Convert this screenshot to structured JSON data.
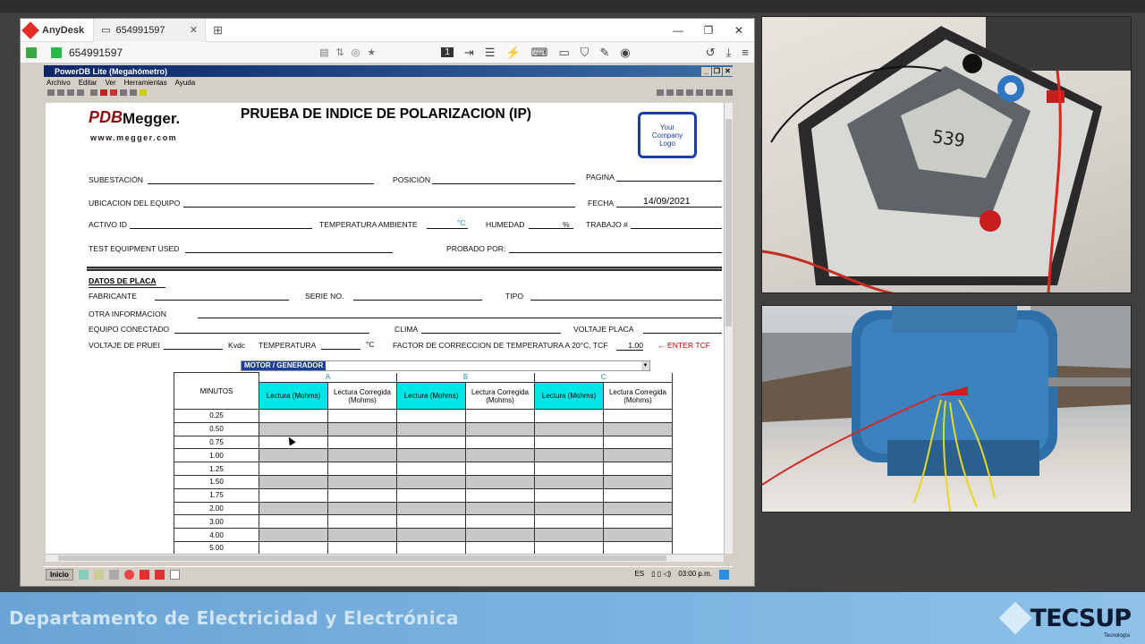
{
  "anydesk": {
    "app_name": "AnyDesk",
    "tab_title": "654991597",
    "address_value": "654991597",
    "monitor_number": "1"
  },
  "powerdb": {
    "window_title": "PowerDB Lite (Megahómetro)",
    "menu": [
      "Archivo",
      "Editar",
      "Ver",
      "Herramientas",
      "Ayuda"
    ]
  },
  "form": {
    "logo_letters": "PDB",
    "brand": "Megger.",
    "website": "www.megger.com",
    "title": "PRUEBA DE INDICE DE POLARIZACION (IP)",
    "company_logo": [
      "Your",
      "Company",
      "Logo"
    ],
    "labels": {
      "subestacion": "SUBESTACIÓN",
      "posicion": "POSICIÓN",
      "pagina": "PAGINA",
      "ubicacion": "UBICACION DEL EQUIPO",
      "fecha": "FECHA",
      "activo": "ACTIVO ID",
      "temp_ambiente": "TEMPERATURA AMBIENTE",
      "temp_unit": "°C",
      "humedad": "HUMEDAD",
      "humedad_unit": "%",
      "trabajo": "TRABAJO #",
      "test_equipment": "TEST EQUIPMENT USED",
      "probado": "PROBADO POR:",
      "datos_placa": "DATOS DE PLACA",
      "fabricante": "FABRICANTE",
      "serie": "SERIE NO.",
      "tipo": "TIPO",
      "otra_info": "OTRA INFORMACION",
      "equipo_conectado": "EQUIPO CONECTADO",
      "clima": "CLIMA",
      "voltaje_placa": "VOLTAJE PLACA",
      "voltaje_prueba": "VOLTAJE DE PRUEI",
      "kvdc": "Kvdc",
      "temperatura": "TEMPERATURA",
      "temperatura_unit": "°C",
      "factor": "FACTOR DE CORRECCION DE TEMPERATURA A 20°C, TCF",
      "enter_tcf": "←  ENTER TCF"
    },
    "values": {
      "fecha": "14/09/2021",
      "tcf": "1.00"
    },
    "dropdown_selected": "MOTOR / GENERADOR"
  },
  "table": {
    "col_minutos": "MINUTOS",
    "groups": [
      "A",
      "B",
      "C"
    ],
    "sub_lectura": "Lectura (Mohms)",
    "sub_corregida": "Lectura Corregida (Mohms)",
    "minutes": [
      "0.25",
      "0.50",
      "0.75",
      "1.00",
      "1.25",
      "1.50",
      "1.75",
      "2.00",
      "3.00",
      "4.00",
      "5.00"
    ]
  },
  "taskbar": {
    "start": "Inicio",
    "lang": "ES",
    "time": "03:00 p.m."
  },
  "camera": {
    "meter_reading": "539"
  },
  "banner": {
    "department": "Departamento de Electricidad  y Electrónica",
    "brand": "TECSUP",
    "brand_sub": "Tecnología"
  },
  "colors": {
    "cyan_header": "#00e5e5",
    "banner_blue": "#7db5e2",
    "dropdown_highlight": "#1c3f9c"
  }
}
